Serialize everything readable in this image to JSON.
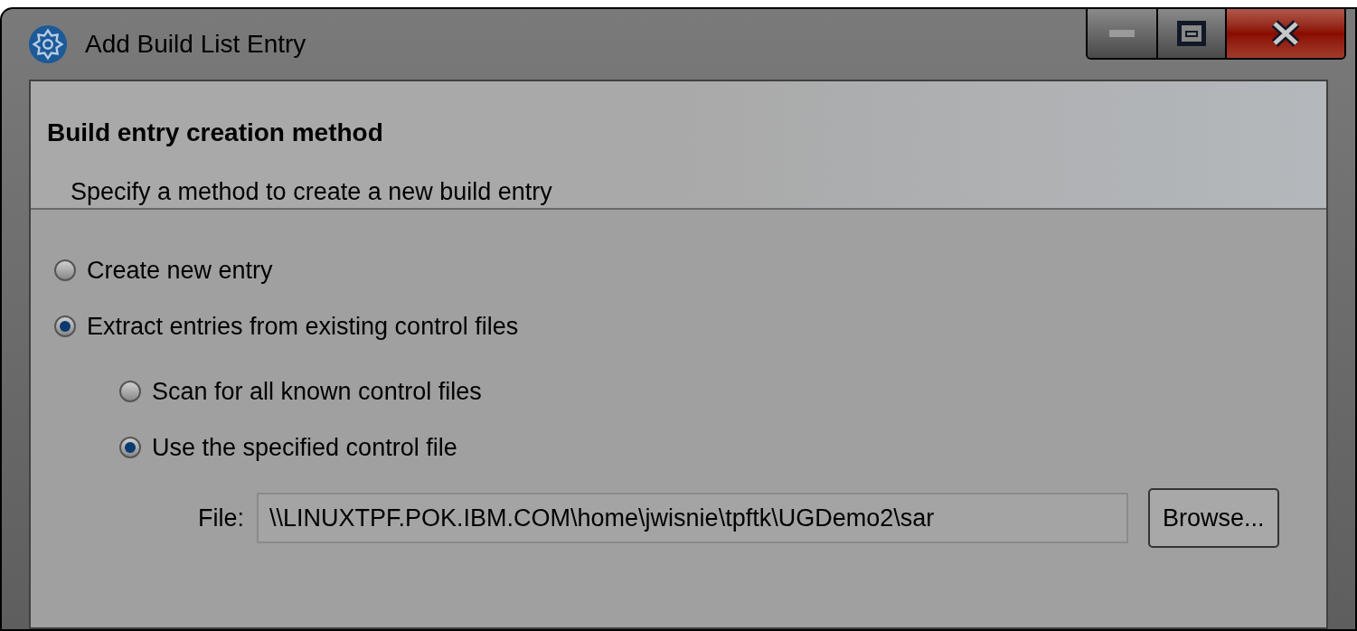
{
  "window": {
    "title": "Add Build List Entry"
  },
  "header": {
    "title": "Build entry creation method",
    "description": "Specify a method to create a new build entry"
  },
  "options": [
    {
      "label": "Create new entry",
      "selected": false
    },
    {
      "label": "Extract entries from existing control files",
      "selected": true,
      "children": [
        {
          "label": "Scan for all known control files",
          "selected": false
        },
        {
          "label": "Use the specified control file",
          "selected": true
        }
      ]
    }
  ],
  "file": {
    "label": "File:",
    "value": "\\\\LINUXTPF.POK.IBM.COM\\home\\jwisnie\\tpftk\\UGDemo2\\sar",
    "button": "Browse..."
  }
}
